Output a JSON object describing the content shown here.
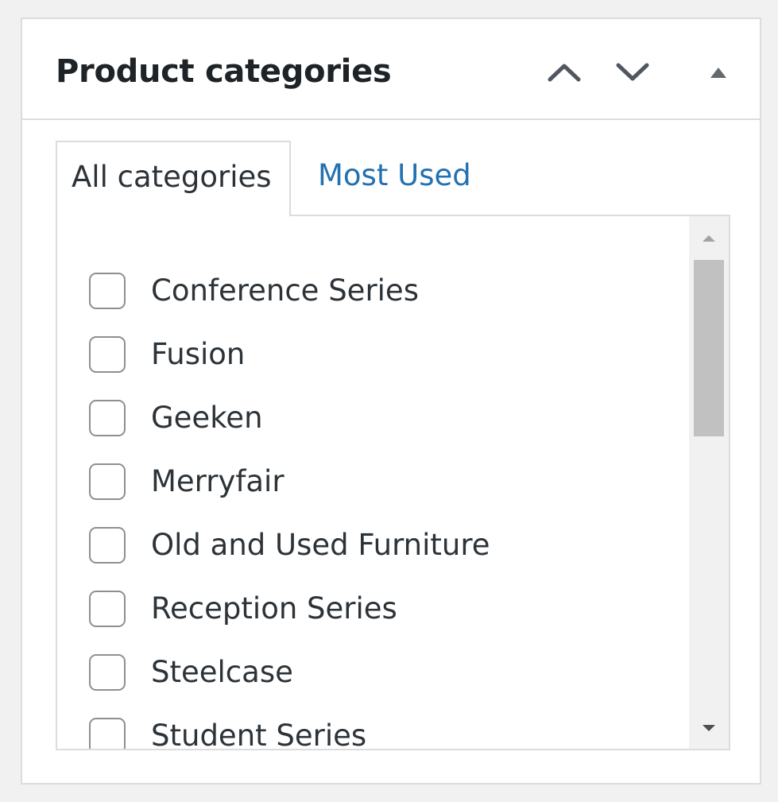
{
  "postbox": {
    "title": "Product categories",
    "move_up_icon": "chevron-up-icon",
    "move_down_icon": "chevron-down-icon",
    "toggle_icon": "triangle-up-icon"
  },
  "tabs": {
    "all_label": "All categories",
    "most_used_label": "Most Used",
    "link_color": "#2271b1"
  },
  "categories": [
    {
      "label": "Conference Series",
      "checked": false
    },
    {
      "label": "Fusion",
      "checked": false
    },
    {
      "label": "Geeken",
      "checked": false
    },
    {
      "label": "Merryfair",
      "checked": false
    },
    {
      "label": "Old and Used Furniture",
      "checked": false
    },
    {
      "label": "Reception Series",
      "checked": false
    },
    {
      "label": "Steelcase",
      "checked": false
    },
    {
      "label": "Student Series",
      "checked": false
    }
  ],
  "scrollbar": {
    "up_icon": "scroll-up-arrow-icon",
    "down_icon": "scroll-down-arrow-icon"
  }
}
